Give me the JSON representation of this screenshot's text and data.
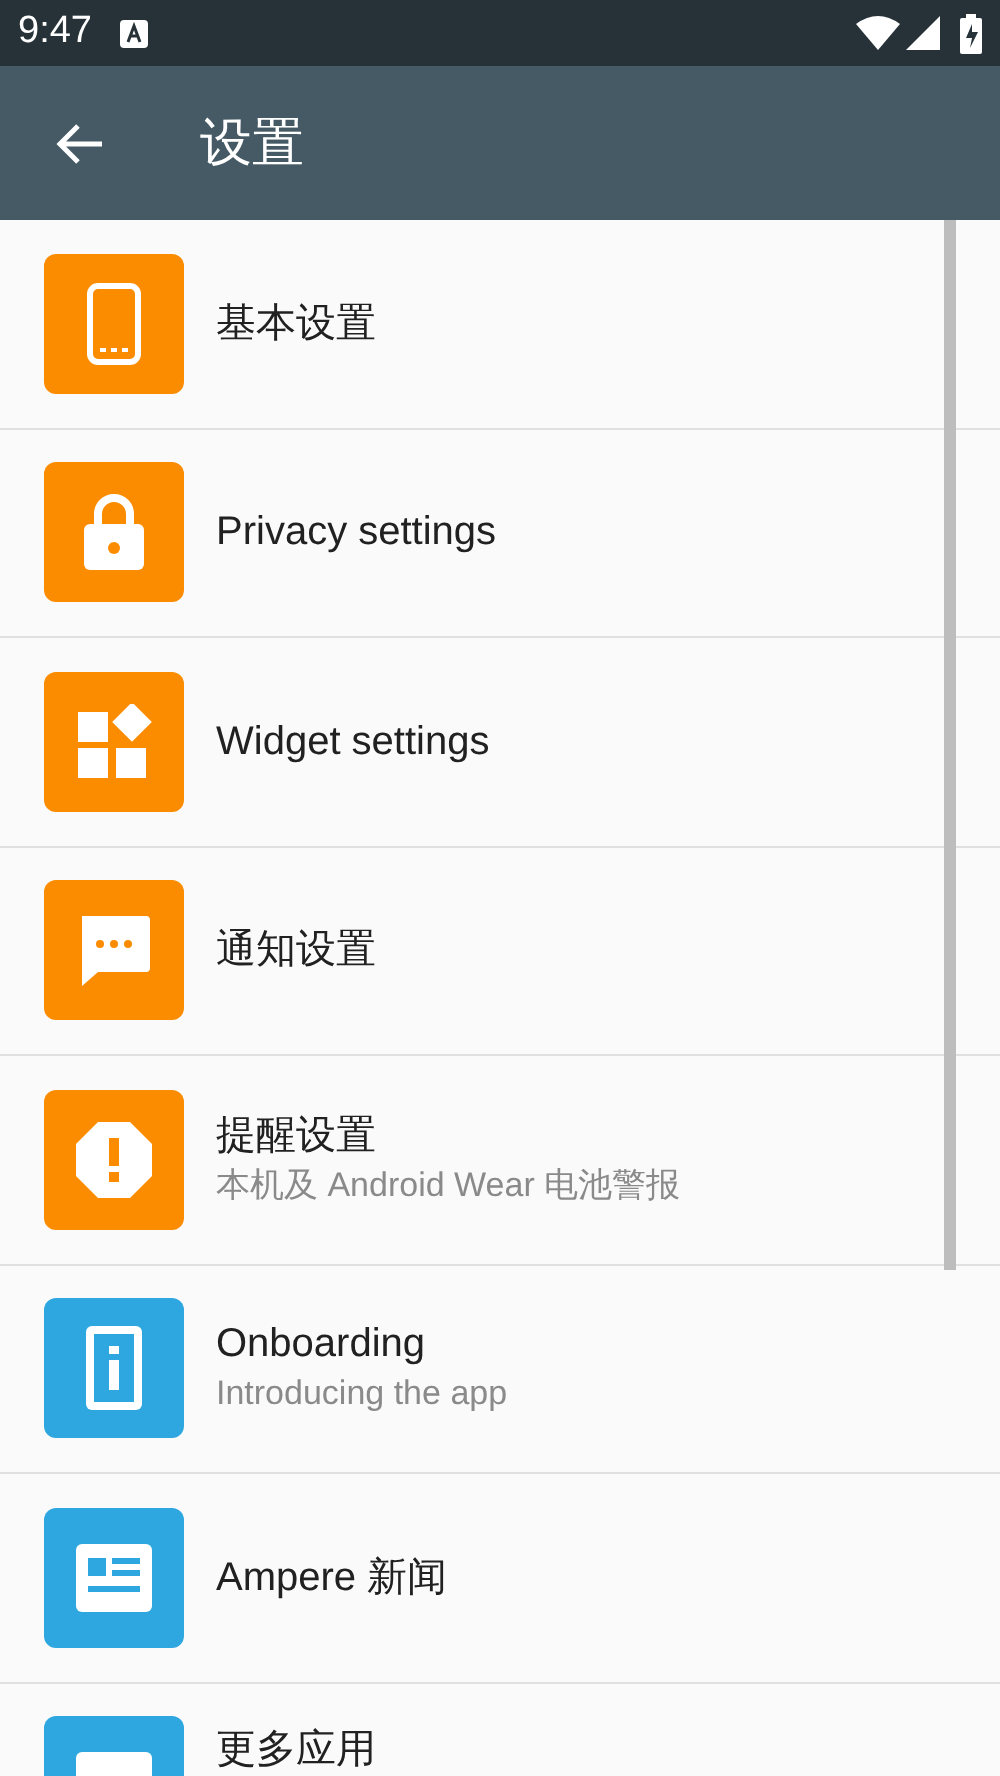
{
  "status_bar": {
    "time": "9:47"
  },
  "app_bar": {
    "title": "设置"
  },
  "items": [
    {
      "title": "基本设置",
      "color": "#fb8c00"
    },
    {
      "title": "Privacy settings",
      "color": "#fb8c00"
    },
    {
      "title": "Widget settings",
      "color": "#fb8c00"
    },
    {
      "title": "通知设置",
      "color": "#fb8c00"
    },
    {
      "title": "提醒设置",
      "subtitle": "本机及 Android Wear 电池警报",
      "color": "#fb8c00"
    },
    {
      "title": "Onboarding",
      "subtitle": "Introducing the app",
      "color": "#2ea7e0"
    },
    {
      "title": "Ampere 新闻",
      "color": "#2ea7e0"
    },
    {
      "title": "更多应用",
      "color": "#2ea7e0"
    }
  ]
}
